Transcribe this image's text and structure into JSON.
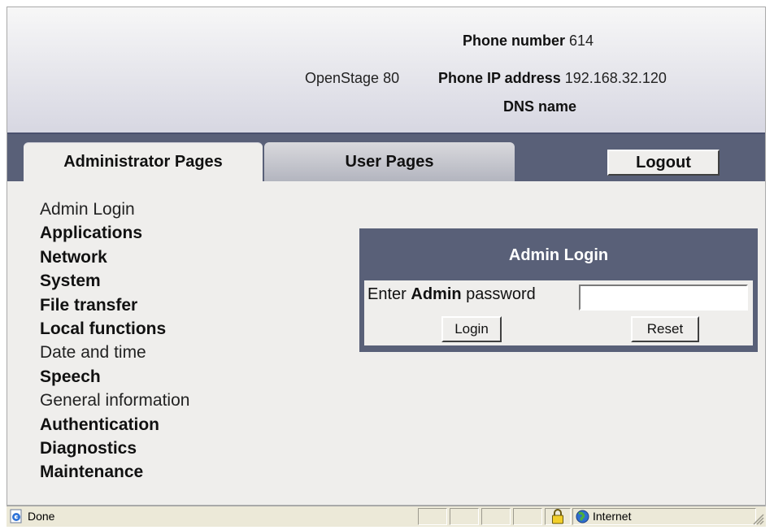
{
  "header": {
    "phone_number_label": "Phone number",
    "phone_number": "614",
    "model": "OpenStage 80",
    "ip_label": "Phone IP address",
    "ip_address": "192.168.32.120",
    "dns_label": "DNS name"
  },
  "tabs": {
    "admin": "Administrator Pages",
    "user": "User Pages",
    "logout": "Logout"
  },
  "menu": [
    "Admin Login",
    "Applications",
    "Network",
    "System",
    "File transfer",
    "Local functions",
    "Date and time",
    "Speech",
    "General information",
    "Authentication",
    "Diagnostics",
    "Maintenance"
  ],
  "login": {
    "title": "Admin Login",
    "prompt_prefix": "Enter",
    "prompt_bold": "Admin",
    "prompt_suffix": "password",
    "password_value": "",
    "login_button": "Login",
    "reset_button": "Reset"
  },
  "statusbar": {
    "status": "Done",
    "zone": "Internet"
  },
  "colors": {
    "header_bar": "#596078",
    "content_bg": "#efeeec"
  },
  "icons": [
    "ie-page-icon",
    "lock-icon",
    "globe-icon",
    "resize-grip-icon"
  ]
}
